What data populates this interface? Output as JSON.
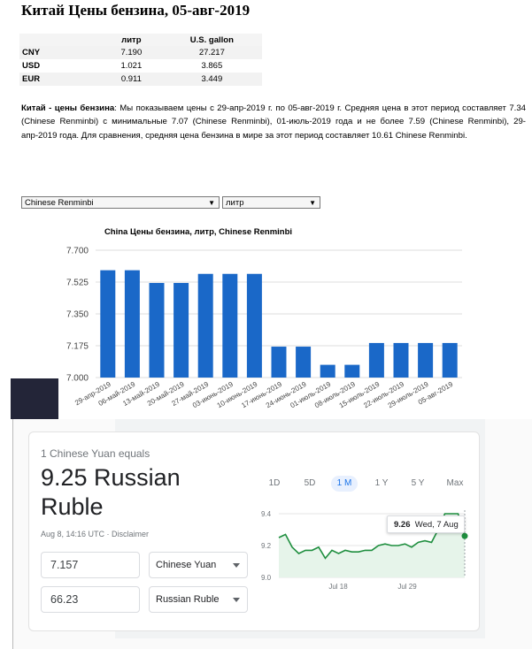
{
  "page": {
    "title": "Китай Цены бензина, 05-авг-2019"
  },
  "price_table": {
    "headers": [
      "",
      "литр",
      "U.S. gallon"
    ],
    "rows": [
      {
        "currency": "CNY",
        "liter": "7.190",
        "gallon": "27.217"
      },
      {
        "currency": "USD",
        "liter": "1.021",
        "gallon": "3.865"
      },
      {
        "currency": "EUR",
        "liter": "0.911",
        "gallon": "3.449"
      }
    ]
  },
  "description": {
    "lead": "Китай - цены бензина",
    "text": ": Мы показываем цены с 29-апр-2019 г. по 05-авг-2019 г. Средняя цена в этот период составляет 7.34 (Chinese Renminbi) с минимальные 7.07 (Chinese Renminbi), 01-июль-2019 года и не более 7.59 (Chinese Renminbi), 29-апр-2019 года. Для сравнения, средняя цена бензина в мире за этот период составляет 10.61 Chinese Renminbi."
  },
  "selectors": {
    "currency": "Chinese Renminbi",
    "unit": "литр"
  },
  "chart_data": {
    "type": "bar",
    "title": "China Цены бензина, литр, Chinese Renminbi",
    "categories": [
      "29-апр-2019",
      "06-май-2019",
      "13-май-2019",
      "20-май-2019",
      "27-май-2019",
      "03-июнь-2019",
      "10-июнь-2019",
      "17-июнь-2019",
      "24-июнь-2019",
      "01-июль-2019",
      "08-июль-2019",
      "15-июль-2019",
      "22-июль-2019",
      "29-июль-2019",
      "05-авг-2019"
    ],
    "values": [
      7.59,
      7.59,
      7.52,
      7.52,
      7.57,
      7.57,
      7.57,
      7.17,
      7.17,
      7.07,
      7.07,
      7.19,
      7.19,
      7.19,
      7.19
    ],
    "ylim": [
      7.0,
      7.7
    ],
    "yticks": [
      "7.700",
      "7.525",
      "7.350",
      "7.175",
      "7.000"
    ],
    "ytick_values": [
      7.7,
      7.525,
      7.35,
      7.175,
      7.0
    ],
    "bar_color": "#1a68c8",
    "grid": true
  },
  "converter": {
    "equals_text": "1 Chinese Yuan equals",
    "result_text": "9.25 Russian Ruble",
    "timestamp": "Aug 8, 14:16 UTC · Disclaimer",
    "amount_from": "7.157",
    "amount_to": "66.23",
    "currency_from": "Chinese Yuan",
    "currency_to": "Russian Ruble",
    "ranges": [
      "1D",
      "5D",
      "1 M",
      "1 Y",
      "5 Y",
      "Max"
    ],
    "active_range": "1 M",
    "tooltip_value": "9.26",
    "tooltip_date": "Wed, 7 Aug",
    "line_color": "#1e8e3e",
    "spark": {
      "yticks": [
        "9.4",
        "9.2",
        "9.0"
      ],
      "ytick_values": [
        9.4,
        9.2,
        9.0
      ],
      "ylim": [
        9.0,
        9.4
      ],
      "xlabels": [
        "Jul 18",
        "Jul 29"
      ],
      "values": [
        9.25,
        9.27,
        9.19,
        9.15,
        9.17,
        9.17,
        9.19,
        9.12,
        9.17,
        9.15,
        9.17,
        9.16,
        9.16,
        9.17,
        9.17,
        9.2,
        9.21,
        9.2,
        9.2,
        9.21,
        9.19,
        9.22,
        9.23,
        9.22,
        9.3,
        9.4,
        9.4,
        9.4,
        9.26
      ]
    }
  }
}
